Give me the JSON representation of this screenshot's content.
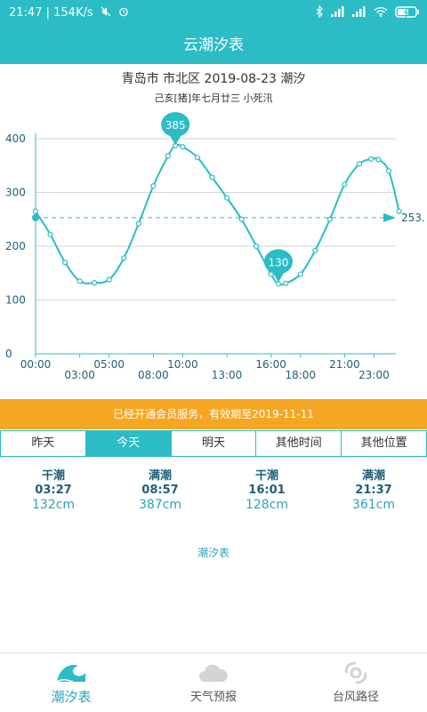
{
  "status_bar": {
    "time": "21:47",
    "speed": "154K/s",
    "icons": [
      "mute-icon",
      "alarm-icon",
      "bluetooth-icon",
      "signal-icon",
      "hd-signal-icon",
      "wifi-icon",
      "battery-icon"
    ]
  },
  "header": {
    "title": "云潮汐表"
  },
  "chart_data": {
    "type": "line",
    "title": "青岛市 市北区 2019-08-23 潮汐",
    "subtitle": "己亥[猪]年七月廿三 小死汛",
    "x_tick_labels": [
      "00:00",
      "03:00",
      "05:00",
      "08:00",
      "10:00",
      "13:00",
      "16:00",
      "18:00",
      "21:00",
      "23:00"
    ],
    "x_ticks_hours": [
      0,
      3,
      5,
      8,
      10,
      13,
      16,
      18,
      21,
      23
    ],
    "ylim": [
      0,
      400
    ],
    "y_ticks": [
      0,
      100,
      200,
      300,
      400
    ],
    "x": [
      0,
      1,
      2,
      3,
      4,
      5,
      6,
      7,
      8,
      9,
      10,
      11,
      12,
      13,
      14,
      15,
      16,
      17,
      18,
      19,
      20,
      21,
      22,
      23,
      24
    ],
    "values": [
      265,
      222,
      170,
      135,
      132,
      138,
      178,
      242,
      312,
      368,
      387,
      385,
      365,
      328,
      290,
      250,
      200,
      148,
      130,
      131,
      148,
      192,
      250,
      315,
      353,
      362,
      361,
      340,
      265
    ],
    "x_hours": [
      0,
      1,
      2,
      3,
      4,
      5,
      6,
      7,
      8,
      9,
      9.5,
      10,
      11,
      12,
      13,
      14,
      15,
      16,
      16.5,
      17,
      18,
      19,
      20,
      21,
      22,
      22.8,
      23.3,
      24,
      24.7
    ],
    "reference": {
      "value": 253,
      "label": "253."
    },
    "markers": [
      {
        "label": "385",
        "value": 385,
        "hour": 9.5
      },
      {
        "label": "130",
        "value": 130,
        "hour": 16.5
      }
    ],
    "colors": {
      "line": "#2bbcc6",
      "grid": "#d6d6d6",
      "marker": "#2bbcc6",
      "axis_text": "#1e5f7a"
    }
  },
  "notice": {
    "text": "已经开通会员服务，有效期至2019-11-11"
  },
  "day_tabs": [
    {
      "label": "昨天",
      "active": false
    },
    {
      "label": "今天",
      "active": true
    },
    {
      "label": "明天",
      "active": false
    },
    {
      "label": "其他时间",
      "active": false
    },
    {
      "label": "其他位置",
      "active": false
    }
  ],
  "tide_events": [
    {
      "type": "干潮",
      "time": "03:27",
      "height": "132cm"
    },
    {
      "type": "满潮",
      "time": "08:57",
      "height": "387cm"
    },
    {
      "type": "干潮",
      "time": "16:01",
      "height": "128cm"
    },
    {
      "type": "满潮",
      "time": "21:37",
      "height": "361cm"
    }
  ],
  "table_link": {
    "label": "潮汐表"
  },
  "bottom_nav": [
    {
      "label": "潮汐表",
      "icon": "wave-icon",
      "active": true
    },
    {
      "label": "天气预报",
      "icon": "cloud-icon",
      "active": false
    },
    {
      "label": "台风路径",
      "icon": "typhoon-icon",
      "active": false
    }
  ]
}
